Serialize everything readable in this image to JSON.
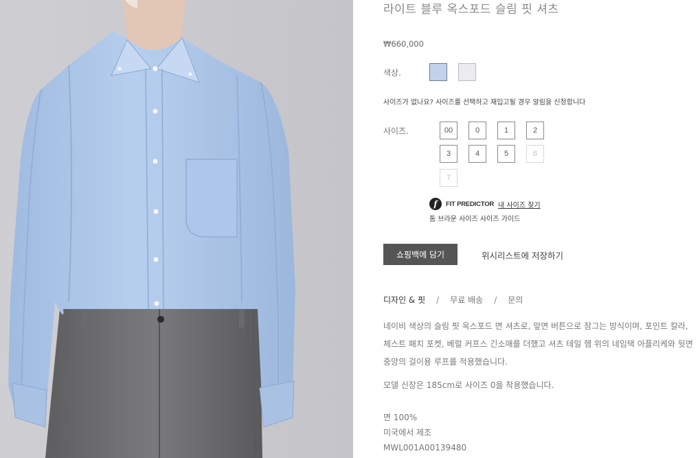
{
  "product": {
    "title": "라이트 블루 옥스포드 슬림 핏 셔츠",
    "price": "₩660,000",
    "color_label": "색상.",
    "colors": [
      {
        "name": "light-blue",
        "hex": "#c4d1ec",
        "selected": true
      },
      {
        "name": "white",
        "hex": "#ececf0",
        "selected": false
      }
    ],
    "size_note": "사이즈가 없나요? 사이즈를 선택하고 재입고될 경우 알림을 신청합니다",
    "size_label": "사이즈.",
    "sizes": [
      {
        "label": "00",
        "available": true
      },
      {
        "label": "0",
        "available": true
      },
      {
        "label": "1",
        "available": true
      },
      {
        "label": "2",
        "available": true
      },
      {
        "label": "3",
        "available": true
      },
      {
        "label": "4",
        "available": true
      },
      {
        "label": "5",
        "available": true
      },
      {
        "label": "6",
        "available": false
      },
      {
        "label": "7",
        "available": false
      }
    ],
    "fit_predictor": {
      "logo": "f",
      "label": "FIT PREDICTOR",
      "link": "내 사이즈 찾기"
    },
    "size_guide": "톰 브라운 사이즈 사이즈 가이드",
    "add_to_cart": "쇼핑백에 담기",
    "wishlist": "위시리스트에 저장하기",
    "tabs": [
      "디자인 & 핏",
      "무료 배송",
      "문의"
    ],
    "tab_separator": "/",
    "description": "네이비 색상의 슬림 핏 옥스포드 면 셔츠로, 앞면 버튼으로 잠그는 방식이며, 포인트 칼라, 체스트 패치 포켓, 베럴 커프스 긴소매를 더했고 셔츠 테일 헴 위의 네임택 아플리케와 뒷면 중앙의 걸이용 루프를 적용했습니다.",
    "model_info": "모델 신장은 185cm로 사이즈 0을 착용했습니다.",
    "material": "면 100%",
    "origin": "미국에서 제조",
    "sku": "MWL001A00139480"
  },
  "colors": {
    "button": "#555555",
    "shirt": "#aec8e8",
    "trousers": "#6e6e70",
    "background": "#c9c9cd"
  }
}
